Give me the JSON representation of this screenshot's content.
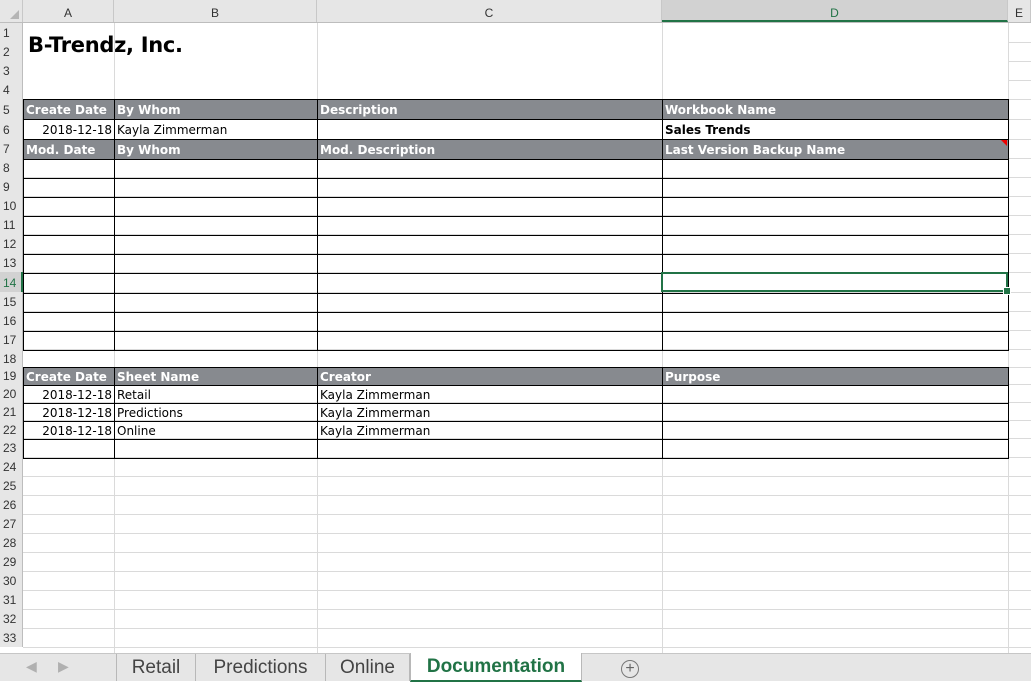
{
  "columns": [
    "A",
    "B",
    "C",
    "D",
    "E"
  ],
  "selected_column": "D",
  "rows": [
    "1",
    "2",
    "3",
    "4",
    "5",
    "6",
    "7",
    "8",
    "9",
    "10",
    "11",
    "12",
    "13",
    "14",
    "15",
    "16",
    "17",
    "18",
    "19",
    "20",
    "21",
    "22",
    "23",
    "24",
    "25",
    "26",
    "27",
    "28",
    "29",
    "30",
    "31",
    "32",
    "33"
  ],
  "selected_row": "14",
  "title": "B-Trendz, Inc.",
  "workbook_table": {
    "header": [
      "Create Date",
      "By Whom",
      "Description",
      "Workbook Name"
    ],
    "row": [
      "2018-12-18",
      "Kayla Zimmerman",
      "",
      "Sales Trends"
    ]
  },
  "modification_table": {
    "header": [
      "Mod. Date",
      "By Whom",
      "Mod. Description",
      "Last Version Backup Name"
    ],
    "rows": [
      [
        "",
        "",
        "",
        ""
      ],
      [
        "",
        "",
        "",
        ""
      ],
      [
        "",
        "",
        "",
        ""
      ],
      [
        "",
        "",
        "",
        ""
      ],
      [
        "",
        "",
        "",
        ""
      ],
      [
        "",
        "",
        "",
        ""
      ],
      [
        "",
        "",
        "",
        ""
      ],
      [
        "",
        "",
        "",
        ""
      ],
      [
        "",
        "",
        "",
        ""
      ],
      [
        "",
        "",
        "",
        ""
      ]
    ]
  },
  "sheets_table": {
    "header": [
      "Create Date",
      "Sheet Name",
      "Creator",
      "Purpose"
    ],
    "rows": [
      [
        "2018-12-18",
        "Retail",
        "Kayla Zimmerman",
        ""
      ],
      [
        "2018-12-18",
        "Predictions",
        "Kayla Zimmerman",
        ""
      ],
      [
        "2018-12-18",
        "Online",
        "Kayla Zimmerman",
        ""
      ],
      [
        "",
        "",
        "",
        ""
      ]
    ]
  },
  "sheet_tabs": [
    {
      "label": "Retail",
      "active": false
    },
    {
      "label": "Predictions",
      "active": false
    },
    {
      "label": "Online",
      "active": false
    },
    {
      "label": "Documentation",
      "active": true
    }
  ],
  "nav": {
    "prev_icon": "◀",
    "next_icon": "▶",
    "add_icon": "+"
  },
  "colors": {
    "accent": "#217346",
    "header_fill": "#878a8f",
    "comment_marker": "#e00000"
  }
}
